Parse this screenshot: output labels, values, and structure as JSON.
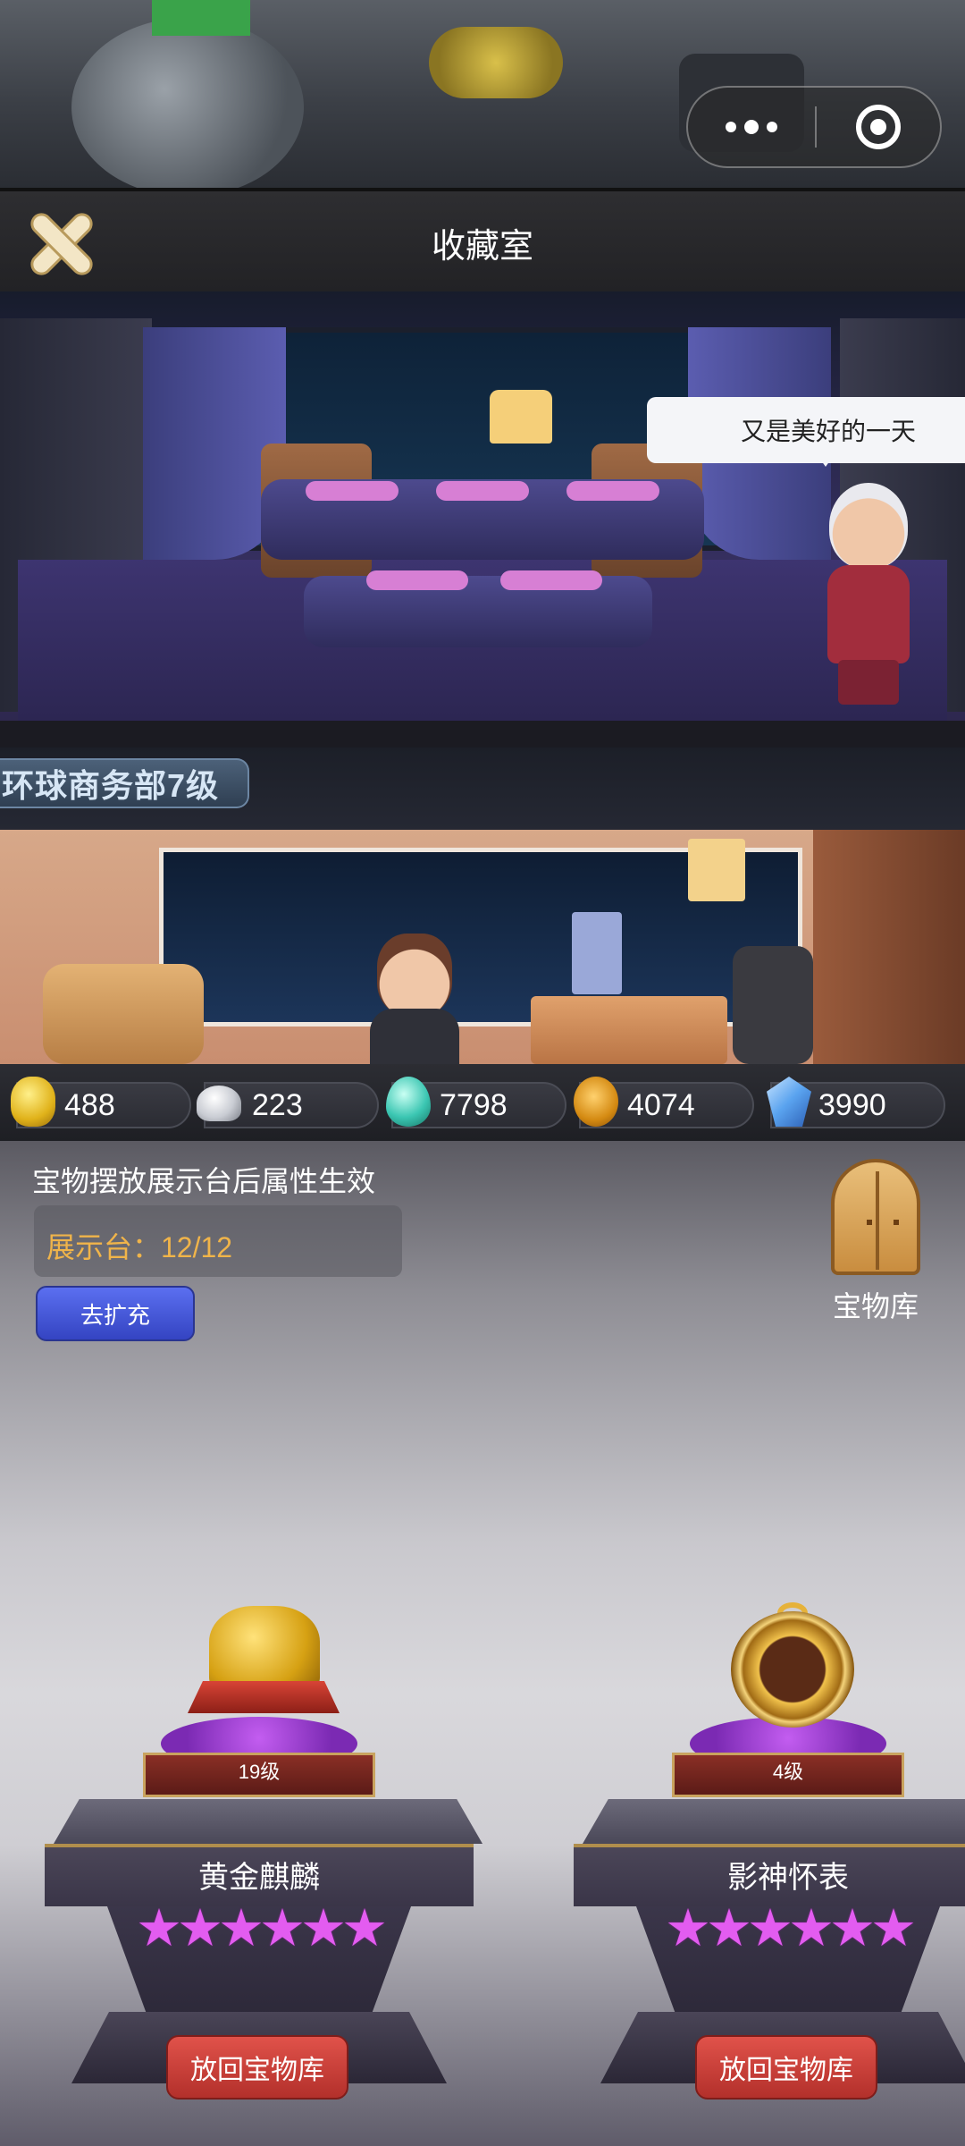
{
  "header": {
    "title": "收藏室"
  },
  "scene": {
    "speech_bubble": "又是美好的一天",
    "floor_label": "环球商务部7级"
  },
  "resources": [
    {
      "icon": "gold-ingot-icon",
      "value": "488"
    },
    {
      "icon": "silver-ingot-icon",
      "value": "223"
    },
    {
      "icon": "green-gem-icon",
      "value": "7798"
    },
    {
      "icon": "coin-icon",
      "value": "4074"
    },
    {
      "icon": "blue-crystal-icon",
      "value": "3990"
    }
  ],
  "collection": {
    "hint": "宝物摆放展示台后属性生效",
    "capacity": "展示台：12/12",
    "expand_button": "去扩充",
    "vault_label": "宝物库"
  },
  "treasures": [
    {
      "name": "黄金麒麟",
      "level": "19级",
      "stars": 6,
      "stars_text": "★★★★★★",
      "return_button": "放回宝物库"
    },
    {
      "name": "影神怀表",
      "level": "4级",
      "stars": 6,
      "stars_text": "★★★★★★",
      "return_button": "放回宝物库"
    }
  ],
  "colors": {
    "capacity_text": "#f0b44a",
    "expand_button": "#4a5ad8",
    "return_button": "#c73b34",
    "star": "#e35cf0"
  }
}
